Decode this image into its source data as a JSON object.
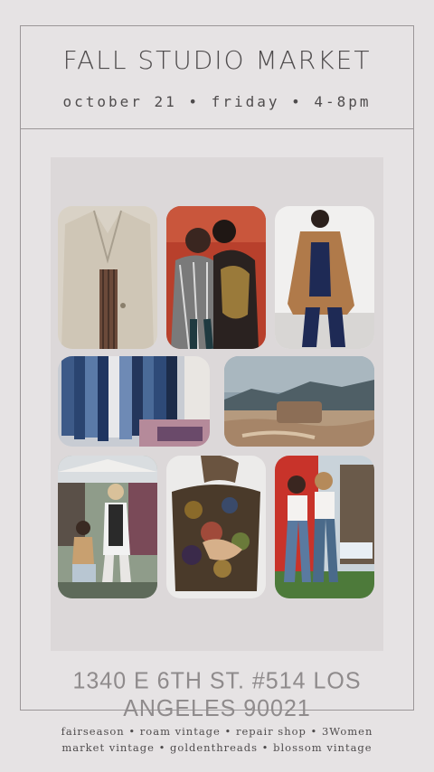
{
  "header": {
    "title": "FALL STUDIO MARKET",
    "subtitle": "october 21 • friday • 4-8pm"
  },
  "collage": {
    "photos": [
      "linen-blazer-photo",
      "two-women-red-backdrop-photo",
      "camel-coat-photo",
      "denim-rack-photo",
      "desert-landscape-photo",
      "market-stall-photo",
      "printed-top-photo",
      "two-women-market-photo"
    ]
  },
  "footer": {
    "address": "1340 E 6TH ST. #514 LOS ANGELES 90021",
    "vendors_line1": "fairseason • roam vintage • repair shop • 3Women",
    "vendors_line2": "market vintage • goldenthreads • blossom vintage"
  },
  "colors": {
    "background": "#e6e3e4",
    "border": "#9b9698",
    "text": "#4f4c4d"
  }
}
